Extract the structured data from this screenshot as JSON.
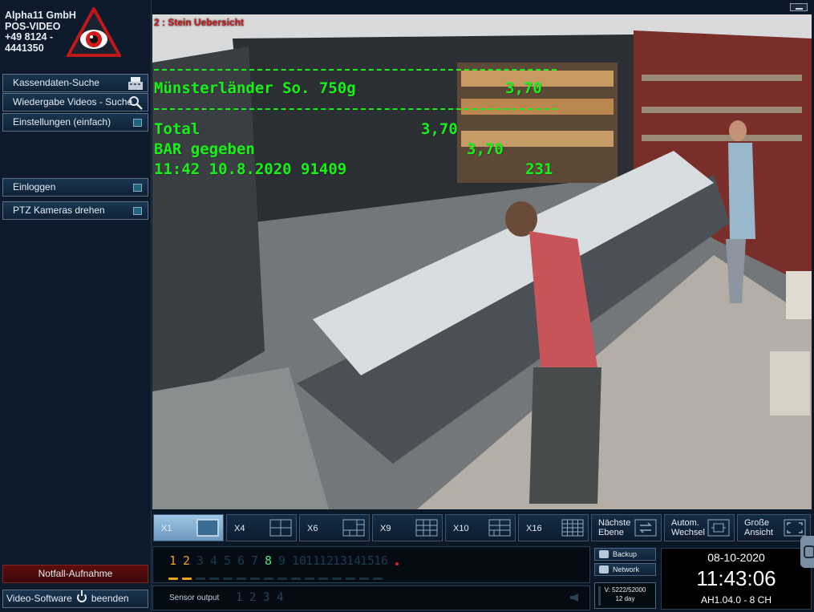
{
  "company": {
    "text": "Alpha11 GmbH\nPOS-VIDEO\n+49 8124 -\n4441350"
  },
  "sidebar": {
    "search_pos": "Kassendaten-Suche",
    "playback_search": "Wiedergabe Videos - Suche",
    "settings": "Einstellungen (einfach)",
    "login": "Einloggen",
    "ptz": "PTZ Kameras drehen",
    "emergency": "Notfall-Aufnahme",
    "exit_prefix": "Video-Software",
    "exit_suffix": "beenden"
  },
  "video": {
    "camera_label": "2 : Stein Uebersicht",
    "pos_overlay": {
      "item_name": "Münsterländer So. 750g",
      "item_price": "3,70",
      "total_label": "Total",
      "total_value": "3,70",
      "cash_label": "BAR gegeben",
      "cash_value": "3,70",
      "receipt_info": "11:42 10.8.2020 91409",
      "receipt_num": "231"
    }
  },
  "layout_bar": {
    "x1": "X1",
    "x4": "X4",
    "x6": "X6",
    "x9": "X9",
    "x10": "X10",
    "x16": "X16",
    "next_level": "Nächste\nEbene",
    "auto_switch": "Autom.\nWechsel",
    "big_view": "Große\nAnsicht"
  },
  "channels": {
    "numbers": [
      "1",
      "2",
      "3",
      "4",
      "5",
      "6",
      "7",
      "8",
      "9",
      "10",
      "11",
      "12",
      "13",
      "14",
      "15",
      "16"
    ],
    "active_orange": [
      1,
      2
    ],
    "active_green": [
      8
    ]
  },
  "sensor": {
    "label": "Sensor output",
    "numbers": [
      "1",
      "2",
      "3",
      "4"
    ]
  },
  "system": {
    "backup": "Backup",
    "network": "Network",
    "disk_line1": "V: 5222/52000",
    "disk_line2": "12 day"
  },
  "clock": {
    "date": "08-10-2020",
    "time": "11:43:06",
    "version": "AH1.04.0 - 8 CH"
  },
  "colors": {
    "overlay_green": "#19f019",
    "camera_label_red": "#c81e1e",
    "emergency_red": "#5e0d0d",
    "panel_bg": "#0b1828"
  }
}
